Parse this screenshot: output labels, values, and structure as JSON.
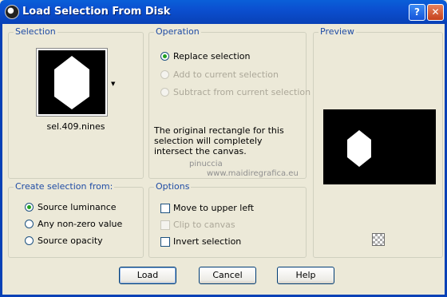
{
  "window": {
    "title": "Load Selection From Disk",
    "help_label": "?",
    "close_label": "✕"
  },
  "selection": {
    "legend": "Selection",
    "filename": "sel.409.nines",
    "dropdown_arrow": "▼"
  },
  "operation": {
    "legend": "Operation",
    "options": [
      {
        "label": "Replace selection",
        "selected": true,
        "enabled": true
      },
      {
        "label": "Add to current selection",
        "selected": false,
        "enabled": false
      },
      {
        "label": "Subtract from current selection",
        "selected": false,
        "enabled": false
      }
    ],
    "message": "The original rectangle for this selection will completely intersect the canvas."
  },
  "preview": {
    "legend": "Preview"
  },
  "create_from": {
    "legend": "Create selection from:",
    "options": [
      {
        "label": "Source luminance",
        "selected": true
      },
      {
        "label": "Any non-zero value",
        "selected": false
      },
      {
        "label": "Source opacity",
        "selected": false
      }
    ]
  },
  "options": {
    "legend": "Options",
    "items": [
      {
        "label": "Move to upper left",
        "checked": false,
        "enabled": true
      },
      {
        "label": "Clip to canvas",
        "checked": false,
        "enabled": false
      },
      {
        "label": "Invert selection",
        "checked": false,
        "enabled": true
      }
    ]
  },
  "buttons": {
    "load": "Load",
    "cancel": "Cancel",
    "help": "Help"
  },
  "watermark": {
    "line1": "pinuccia",
    "line2": "www.maidiregrafica.eu"
  }
}
